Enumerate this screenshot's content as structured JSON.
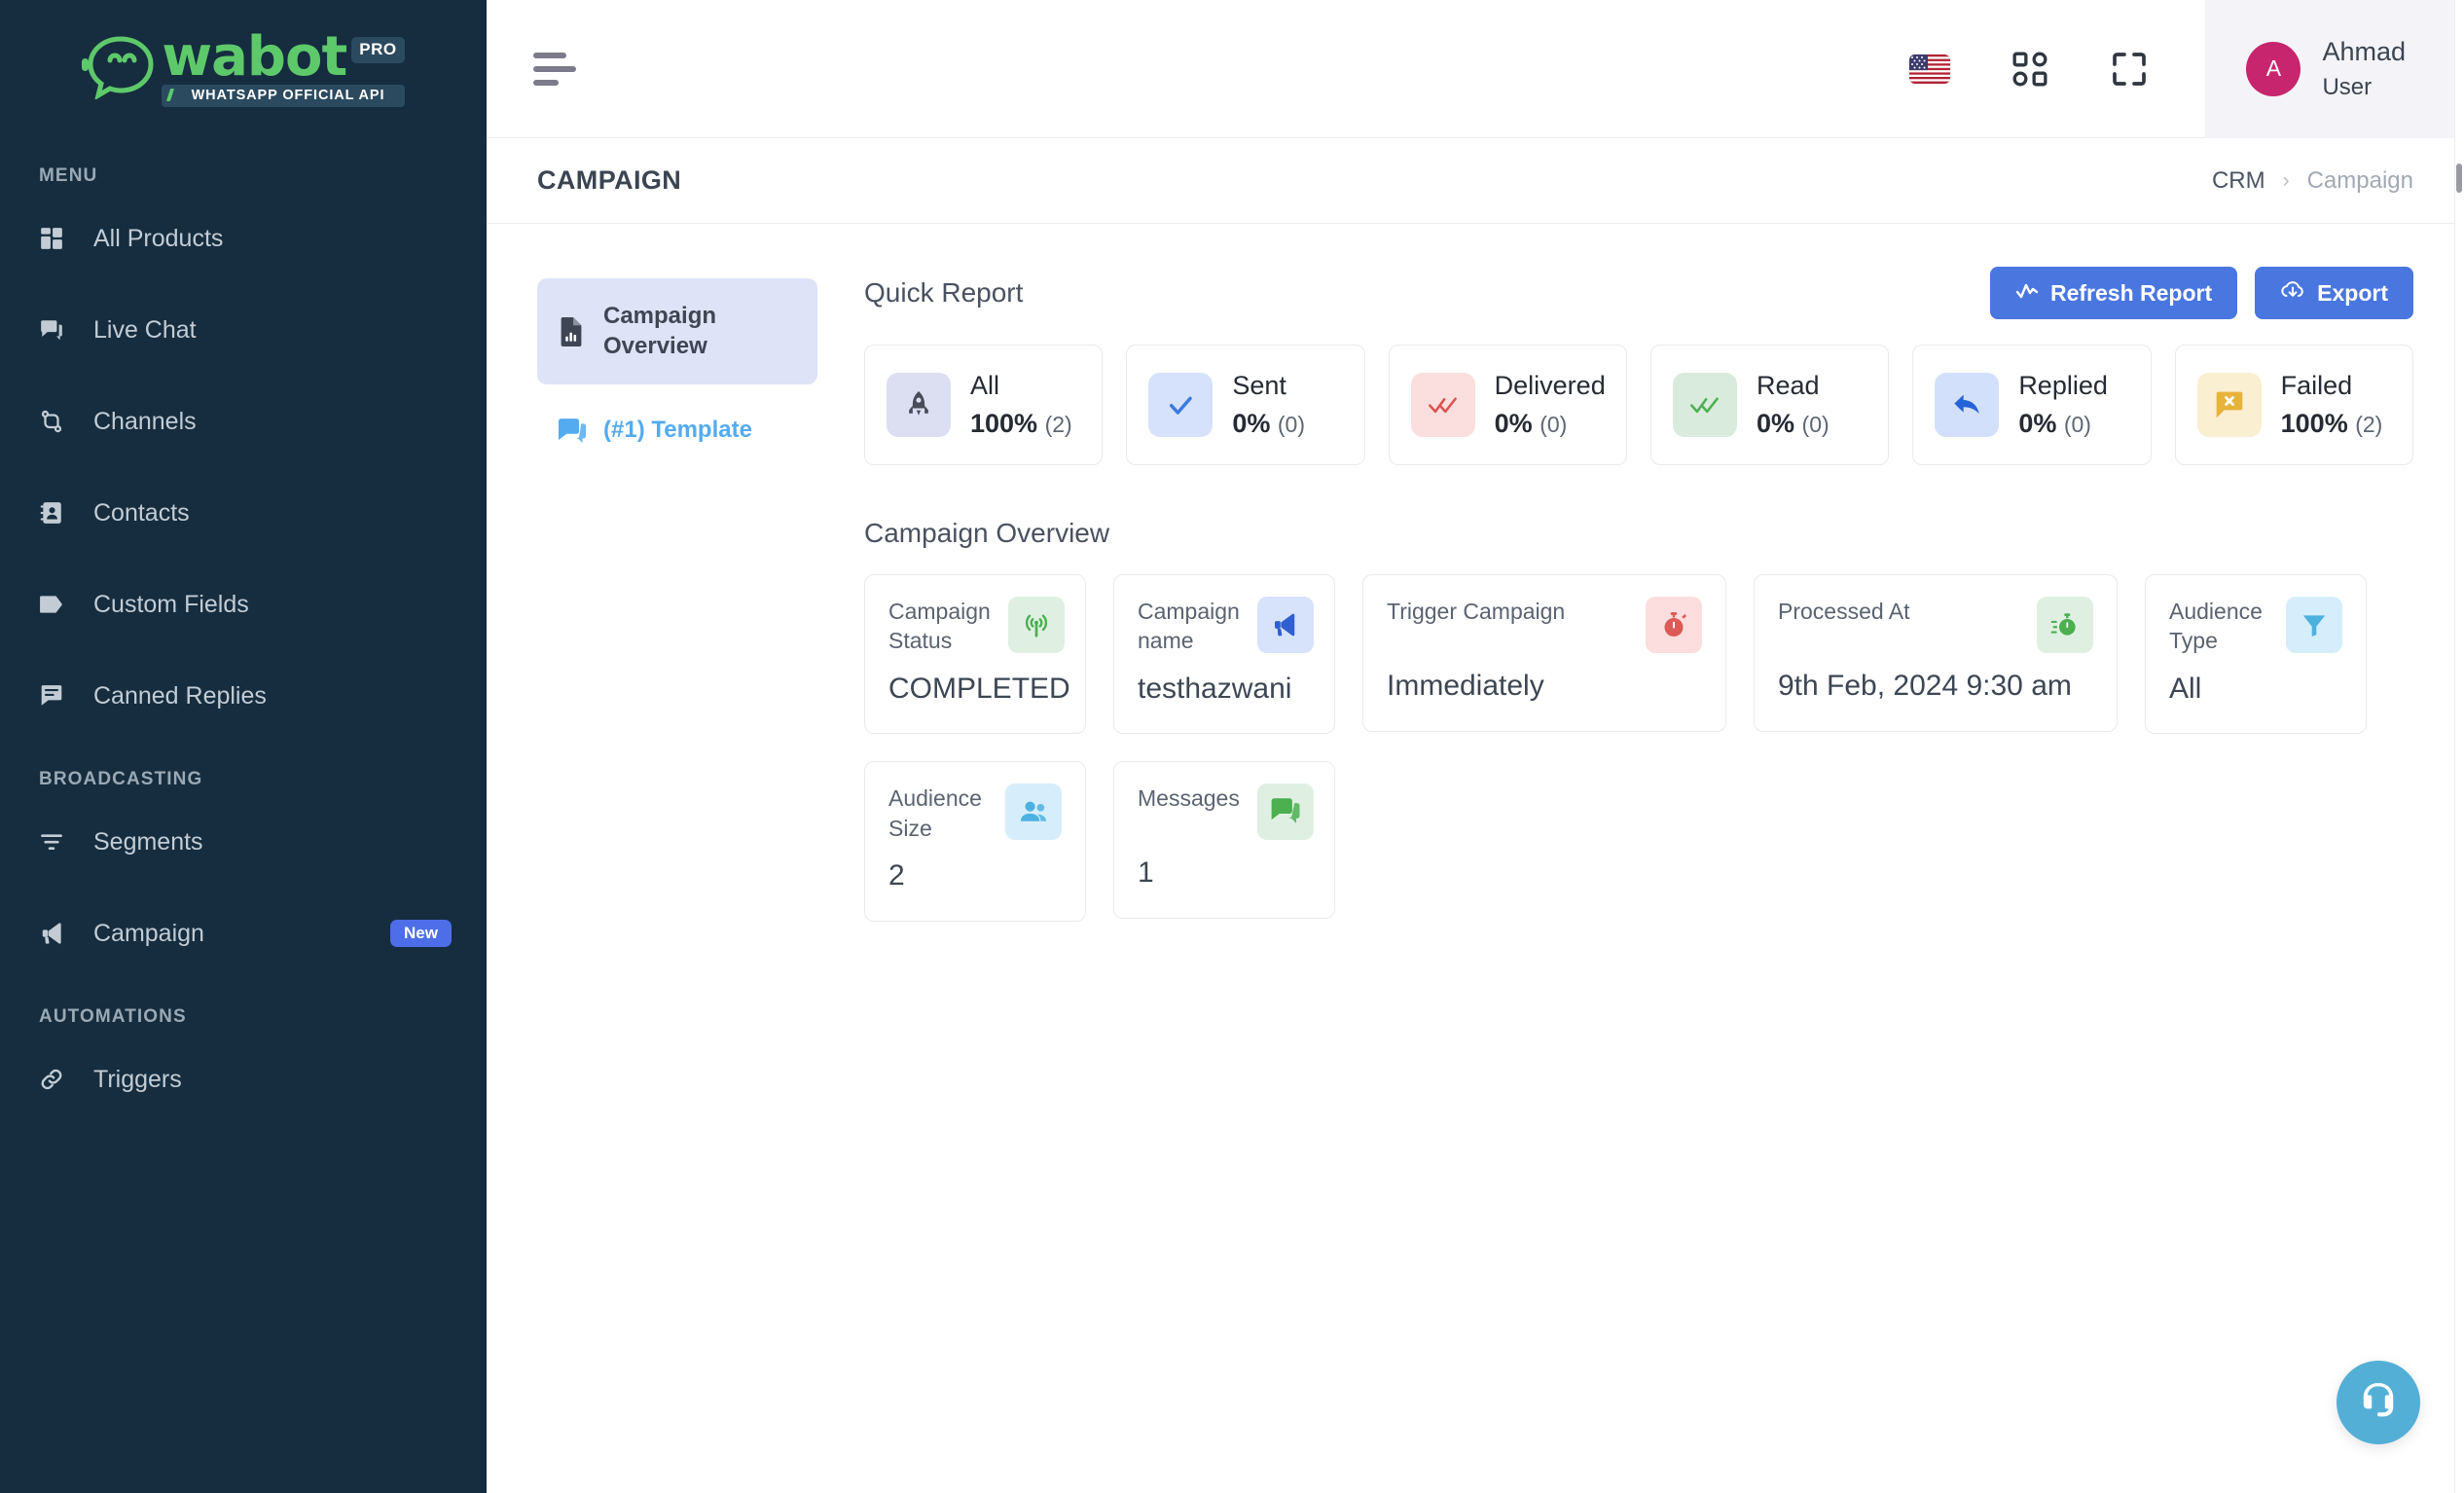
{
  "brand": {
    "logo_word": "wabot",
    "logo_badge": "PRO",
    "logo_tagline": "WHATSAPP OFFICIAL API",
    "accent_green": "#5ec96a",
    "sidebar_bg": "#152d3f"
  },
  "sidebar": {
    "sections": [
      {
        "title": "MENU",
        "items": [
          {
            "label": "All Products",
            "icon": "grid-icon",
            "badge": null
          },
          {
            "label": "Live Chat",
            "icon": "chat-icon",
            "badge": null
          },
          {
            "label": "Channels",
            "icon": "channels-icon",
            "badge": null
          },
          {
            "label": "Contacts",
            "icon": "contacts-icon",
            "badge": null
          },
          {
            "label": "Custom Fields",
            "icon": "tag-icon",
            "badge": null
          },
          {
            "label": "Canned Replies",
            "icon": "canned-reply-icon",
            "badge": null
          }
        ]
      },
      {
        "title": "BROADCASTING",
        "items": [
          {
            "label": "Segments",
            "icon": "filter-icon",
            "badge": null
          },
          {
            "label": "Campaign",
            "icon": "megaphone-icon",
            "badge": "New"
          }
        ]
      },
      {
        "title": "AUTOMATIONS",
        "items": [
          {
            "label": "Triggers",
            "icon": "link-icon",
            "badge": null
          }
        ]
      }
    ]
  },
  "topbar": {
    "menu_toggle": "hamburger-icon",
    "language_flag": "us-flag-icon",
    "apps_icon": "apps-grid-icon",
    "fullscreen_icon": "fullscreen-icon",
    "user": {
      "initial": "A",
      "name": "Ahmad",
      "role": "User",
      "avatar_color": "#c7256e"
    }
  },
  "page": {
    "title": "CAMPAIGN",
    "breadcrumb": {
      "root": "CRM",
      "separator": "›",
      "current": "Campaign"
    }
  },
  "side_tabs": [
    {
      "label": "Campaign Overview",
      "icon": "report-doc-icon",
      "active": true
    },
    {
      "label": "(#1) Template",
      "icon": "template-chat-icon",
      "active": false
    }
  ],
  "quick_report": {
    "title": "Quick Report",
    "refresh_label": "Refresh Report",
    "refresh_icon": "pulse-icon",
    "export_label": "Export",
    "export_icon": "cloud-download-icon",
    "cards": [
      {
        "label": "All",
        "percent": "100%",
        "count": "(2)",
        "icon": "rocket-icon",
        "icon_bg": "#dcdff2",
        "icon_color": "#474c58"
      },
      {
        "label": "Sent",
        "percent": "0%",
        "count": "(0)",
        "icon": "single-check-icon",
        "icon_bg": "#d6e2fb",
        "icon_color": "#3b7ae0"
      },
      {
        "label": "Delivered",
        "percent": "0%",
        "count": "(0)",
        "icon": "double-check-icon",
        "icon_bg": "#fbdede",
        "icon_color": "#d9534f"
      },
      {
        "label": "Read",
        "percent": "0%",
        "count": "(0)",
        "icon": "double-check-icon",
        "icon_bg": "#d9ebdc",
        "icon_color": "#4caf50"
      },
      {
        "label": "Replied",
        "percent": "0%",
        "count": "(0)",
        "icon": "reply-arrow-icon",
        "icon_bg": "#d3e0fb",
        "icon_color": "#2563d9"
      },
      {
        "label": "Failed",
        "percent": "100%",
        "count": "(2)",
        "icon": "failed-message-icon",
        "icon_bg": "#fbefd2",
        "icon_color": "#e8b339"
      }
    ]
  },
  "campaign_overview": {
    "title": "Campaign Overview",
    "cards": [
      {
        "label": "Campaign Status",
        "value": "COMPLETED",
        "icon": "broadcast-tower-icon",
        "icon_bg": "#dff0e2",
        "icon_color": "#4caf50"
      },
      {
        "label": "Campaign name",
        "value": "testhazwani",
        "icon": "megaphone-icon",
        "icon_bg": "#d7e2fb",
        "icon_color": "#2f5fd0"
      },
      {
        "label": "Trigger Campaign",
        "value": "Immediately",
        "icon": "stopwatch-icon",
        "icon_bg": "#fbdedd",
        "icon_color": "#dd5b57"
      },
      {
        "label": "Processed At",
        "value": "9th Feb, 2024 9:30 am",
        "icon": "stopwatch-speed-icon",
        "icon_bg": "#dff0e2",
        "icon_color": "#4caf50"
      },
      {
        "label": "Audience Type",
        "value": "All",
        "icon": "funnel-icon",
        "icon_bg": "#d6eefb",
        "icon_color": "#4db1e0"
      },
      {
        "label": "Audience Size",
        "value": "2",
        "icon": "users-icon",
        "icon_bg": "#d6eefb",
        "icon_color": "#4db1e0"
      },
      {
        "label": "Messages",
        "value": "1",
        "icon": "messages-icon",
        "icon_bg": "#dff0e2",
        "icon_color": "#4caf50"
      }
    ]
  },
  "support": {
    "icon": "headset-support-icon",
    "color": "#53afd6"
  }
}
